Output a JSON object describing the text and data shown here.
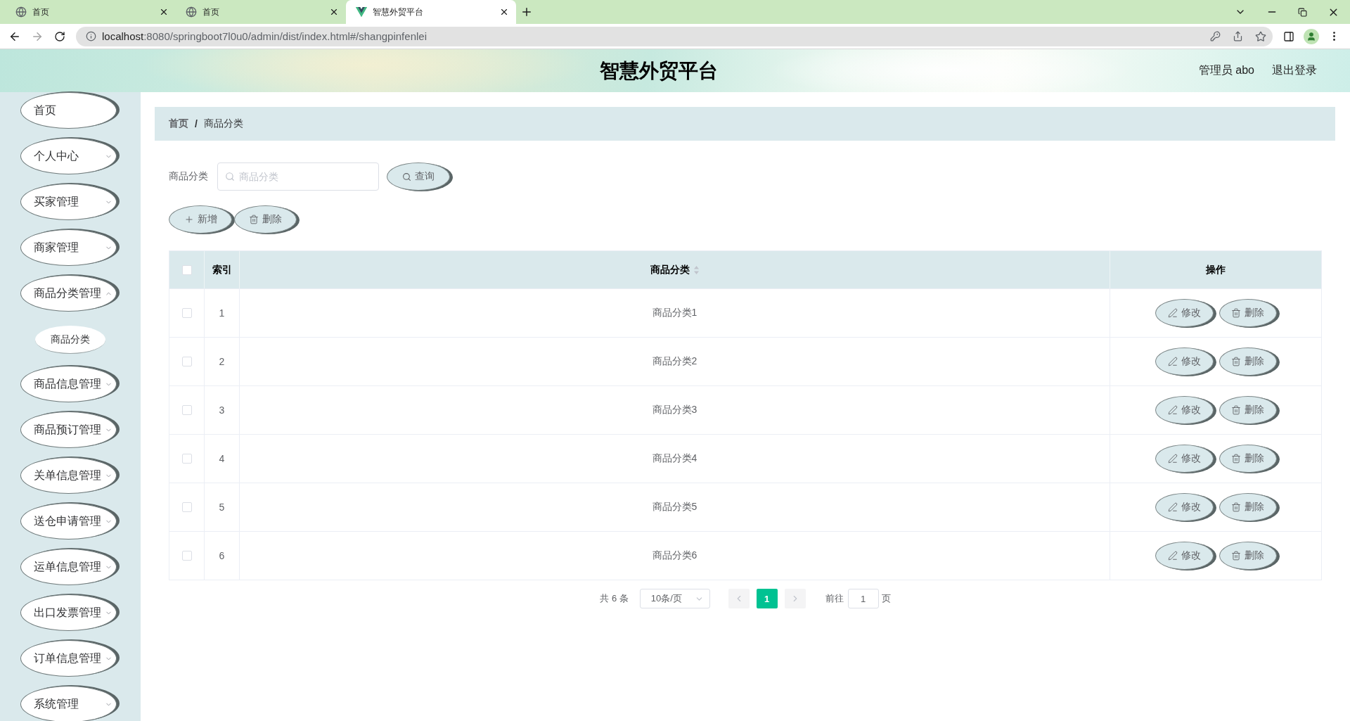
{
  "browser": {
    "tabs": [
      {
        "kind": "globe",
        "title": "首页",
        "selected": false
      },
      {
        "kind": "globe",
        "title": "首页",
        "selected": false
      },
      {
        "kind": "vue",
        "title": "智慧外贸平台",
        "selected": true
      }
    ],
    "nav": {
      "back_disabled": false,
      "forward_disabled": true
    },
    "url": {
      "host": "localhost",
      "path": ":8080/springboot7l0u0/admin/dist/index.html#/shangpinfenlei"
    }
  },
  "header": {
    "title": "智慧外贸平台",
    "user": "管理员 abo",
    "logout": "退出登录"
  },
  "sidebar": {
    "items": [
      {
        "label": "首页"
      },
      {
        "label": "个人中心",
        "expanded": false
      },
      {
        "label": "买家管理",
        "expanded": false
      },
      {
        "label": "商家管理",
        "expanded": false
      },
      {
        "label": "商品分类管理",
        "expanded": true,
        "children": [
          {
            "label": "商品分类"
          }
        ]
      },
      {
        "label": "商品信息管理",
        "expanded": false
      },
      {
        "label": "商品预订管理",
        "expanded": false
      },
      {
        "label": "关单信息管理",
        "expanded": false
      },
      {
        "label": "送仓申请管理",
        "expanded": false
      },
      {
        "label": "运单信息管理",
        "expanded": false
      },
      {
        "label": "出口发票管理",
        "expanded": false
      },
      {
        "label": "订单信息管理",
        "expanded": false
      },
      {
        "label": "系统管理",
        "expanded": false
      }
    ]
  },
  "breadcrumb": {
    "items": [
      "首页",
      "商品分类"
    ],
    "separator": "/"
  },
  "search": {
    "label": "商品分类",
    "placeholder": "商品分类",
    "button": "查询"
  },
  "toolbar": [
    {
      "kind": "add",
      "label": "新增"
    },
    {
      "kind": "delete",
      "label": "删除"
    }
  ],
  "table": {
    "select_all": {
      "checked": false
    },
    "columns": [
      {
        "label": "索引",
        "sortable": false
      },
      {
        "label": "商品分类",
        "sortable": true
      },
      {
        "label": "操作",
        "sortable": false
      }
    ],
    "rows": [
      {
        "checked": false,
        "index": "1",
        "name": "商品分类1",
        "actions": [
          {
            "kind": "edit",
            "label": "修改"
          },
          {
            "kind": "delete",
            "label": "删除"
          }
        ]
      },
      {
        "checked": false,
        "index": "2",
        "name": "商品分类2",
        "actions": [
          {
            "kind": "edit",
            "label": "修改"
          },
          {
            "kind": "delete",
            "label": "删除"
          }
        ]
      },
      {
        "checked": false,
        "index": "3",
        "name": "商品分类3",
        "actions": [
          {
            "kind": "edit",
            "label": "修改"
          },
          {
            "kind": "delete",
            "label": "删除"
          }
        ]
      },
      {
        "checked": false,
        "index": "4",
        "name": "商品分类4",
        "actions": [
          {
            "kind": "edit",
            "label": "修改"
          },
          {
            "kind": "delete",
            "label": "删除"
          }
        ]
      },
      {
        "checked": false,
        "index": "5",
        "name": "商品分类5",
        "actions": [
          {
            "kind": "edit",
            "label": "修改"
          },
          {
            "kind": "delete",
            "label": "删除"
          }
        ]
      },
      {
        "checked": false,
        "index": "6",
        "name": "商品分类6",
        "actions": [
          {
            "kind": "edit",
            "label": "修改"
          },
          {
            "kind": "delete",
            "label": "删除"
          }
        ]
      }
    ]
  },
  "pagination": {
    "total": "共 6 条",
    "page_size": "10条/页",
    "prev_disabled": true,
    "next_disabled": true,
    "pages": [
      {
        "label": "1",
        "selected": true
      }
    ],
    "goto_label": "前往",
    "goto_value": "1",
    "goto_suffix": "页"
  }
}
